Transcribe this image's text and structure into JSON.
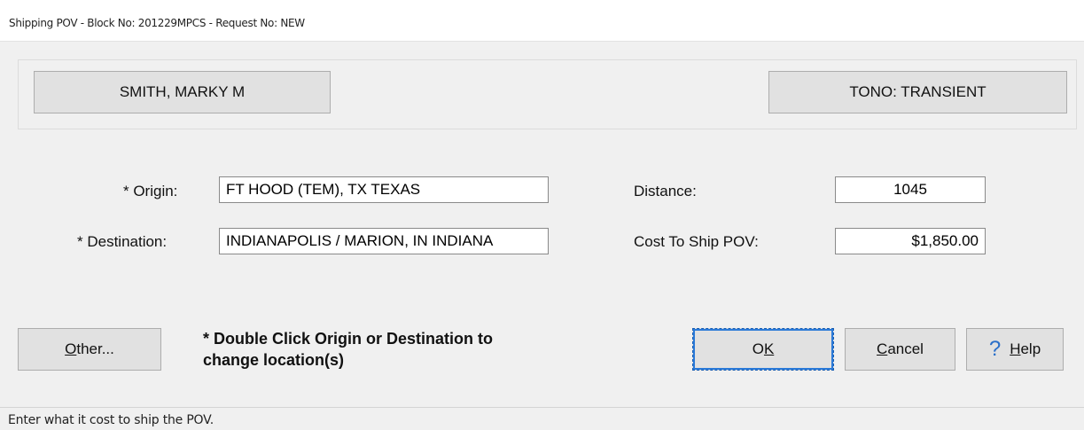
{
  "window": {
    "title": "Shipping POV - Block No: 201229MPCS - Request No: NEW"
  },
  "header": {
    "member_name": "SMITH, MARKY M",
    "tono": "TONO: TRANSIENT"
  },
  "form": {
    "origin_label": "* Origin:",
    "origin_value": "FT HOOD    (TEM), TX TEXAS",
    "destination_label": "* Destination:",
    "destination_value": "INDIANAPOLIS / MARION, IN INDIANA",
    "distance_label": "Distance:",
    "distance_value": "1045",
    "cost_label": "Cost To Ship POV:",
    "cost_value": "$1,850.00"
  },
  "buttons": {
    "other_mnemonic": "O",
    "other_rest": "ther...",
    "ok_prefix": "O",
    "ok_mnemonic": "K",
    "cancel_mnemonic": "C",
    "cancel_rest": "ancel",
    "help_icon": "?",
    "help_mnemonic": "H",
    "help_rest": "elp"
  },
  "note": {
    "line1": "* Double Click Origin or Destination to",
    "line2": "change location(s)"
  },
  "status": {
    "text": "Enter what it cost to ship the POV."
  },
  "colors": {
    "accent": "#2b7ad8",
    "help_icon": "#2a6fc9"
  }
}
